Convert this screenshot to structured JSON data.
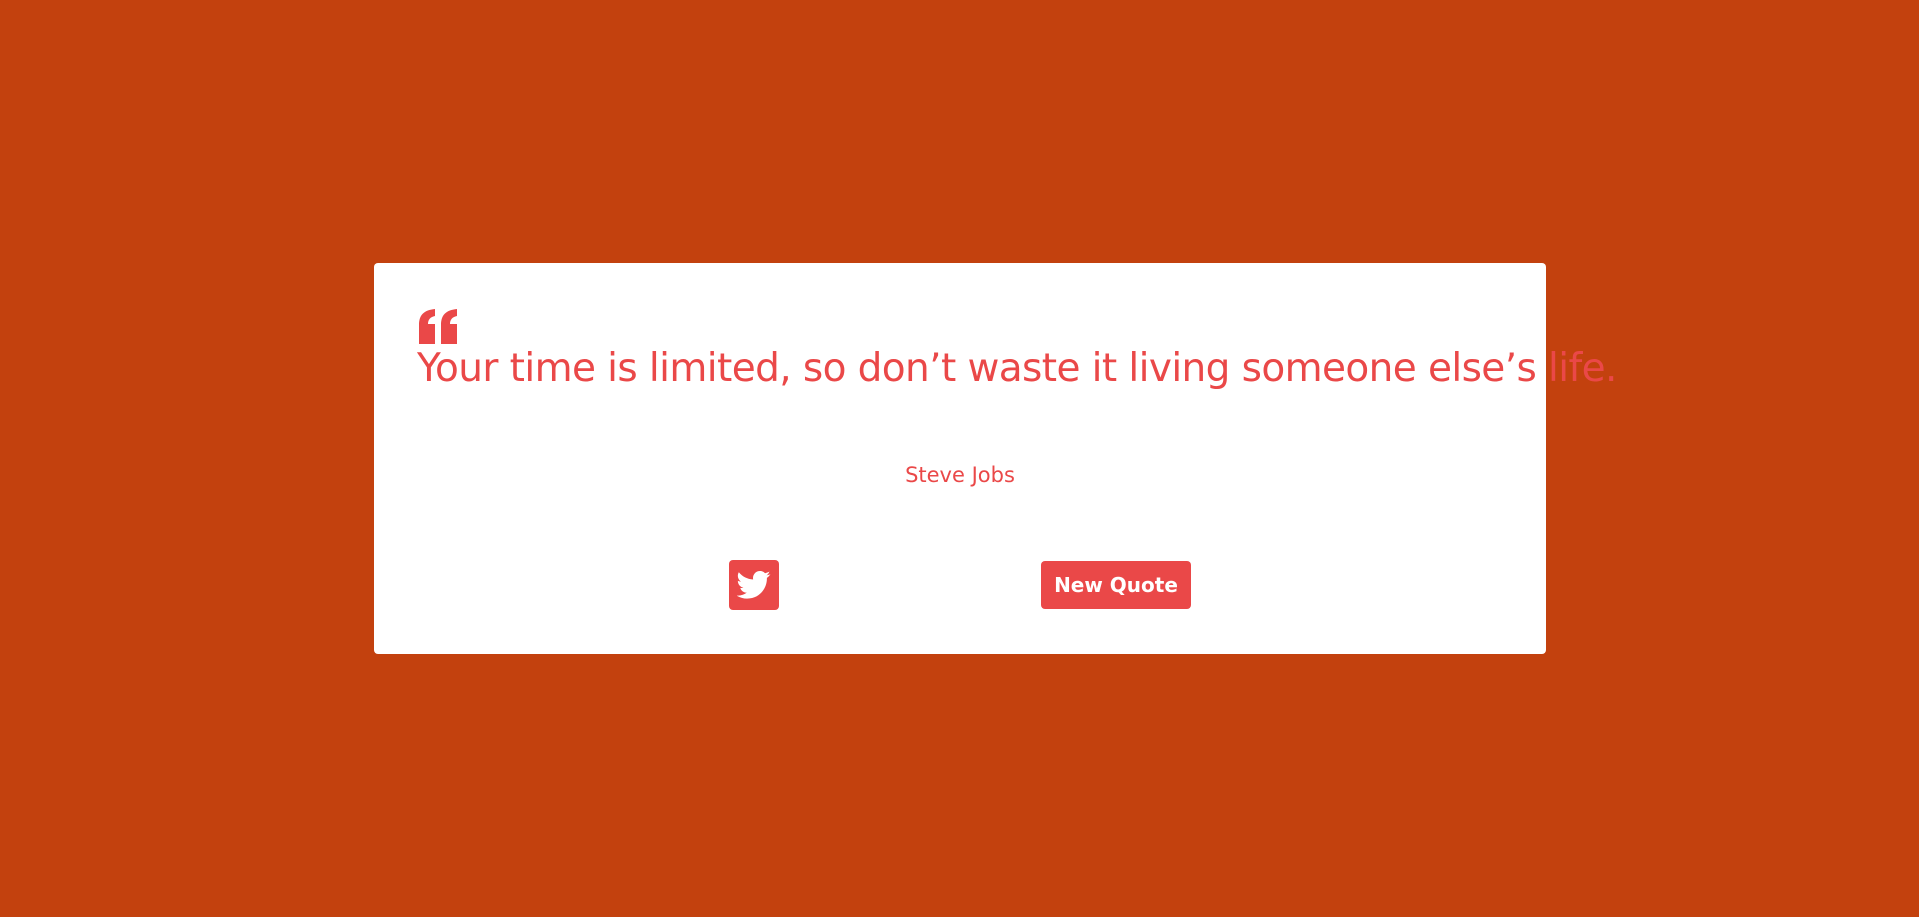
{
  "colors": {
    "background": "#c3410e",
    "card": "#ffffff",
    "accent": "#ea4848"
  },
  "quote": {
    "text": "Your time is limited, so don’t waste it living someone else’s life.",
    "author": "Steve Jobs",
    "quote_icon": "quote-left-icon"
  },
  "actions": {
    "tweet_icon": "twitter-icon",
    "new_quote_label": "New Quote"
  }
}
